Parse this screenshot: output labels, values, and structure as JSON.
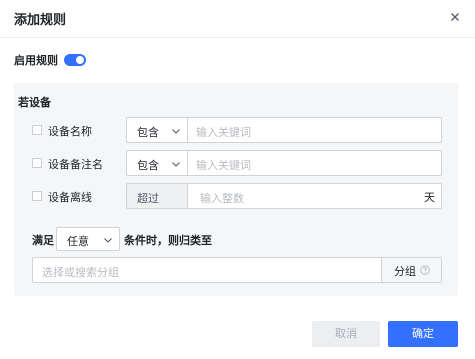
{
  "dialog": {
    "title": "添加规则",
    "close_icon": "close-icon"
  },
  "enable": {
    "label": "启用规则",
    "on": true,
    "accent": "#3370ff"
  },
  "conditions": {
    "section_title": "若设备",
    "rows": [
      {
        "label": "设备名称",
        "operator": "包含",
        "placeholder": "输入关键词",
        "checked": false
      },
      {
        "label": "设备备注名",
        "operator": "包含",
        "placeholder": "输入关键词",
        "checked": false
      },
      {
        "label": "设备离线",
        "operator": "超过",
        "placeholder": "输入整数",
        "unit": "天",
        "checked": false
      }
    ]
  },
  "match": {
    "prefix": "满足",
    "mode": "任意",
    "suffix": "条件时，则归类至"
  },
  "group": {
    "placeholder": "选择或搜索分组",
    "addon_label": "分组",
    "help_icon": "help-circle-icon"
  },
  "footer": {
    "cancel_label": "取消",
    "confirm_label": "确定"
  }
}
